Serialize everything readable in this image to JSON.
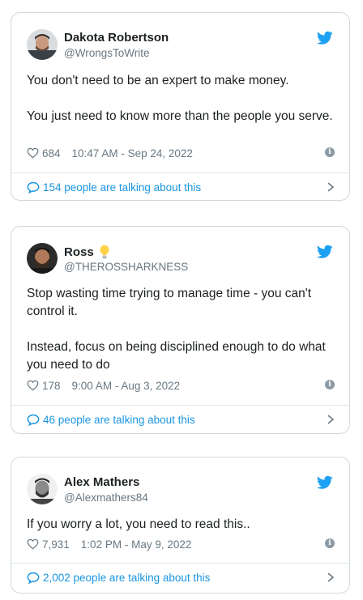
{
  "colors": {
    "twitter_blue": "#1da1f2",
    "link_blue": "#1b95e0",
    "muted": "#697882",
    "border": "#cfd9de"
  },
  "tweets": [
    {
      "name": "Dakota Robertson",
      "handle": "@WrongsToWrite",
      "badge_icon": null,
      "paragraphs": [
        "You don't need to be an expert to make money.",
        "You just need to know more than the people you serve."
      ],
      "likes": "684",
      "timestamp": "10:47 AM - Sep 24, 2022",
      "talking": "154 people are talking about this"
    },
    {
      "name": "Ross",
      "handle": "@THEROSSHARKNESS",
      "badge_icon": "lightbulb-icon",
      "paragraphs": [
        "Stop wasting time trying to manage time - you can't control it.",
        "Instead, focus on being disciplined enough to do what you need to do"
      ],
      "likes": "178",
      "timestamp": "9:00 AM - Aug 3, 2022",
      "talking": "46 people are talking about this"
    },
    {
      "name": "Alex Mathers",
      "handle": "@Alexmathers84",
      "badge_icon": null,
      "paragraphs": [
        "If you worry a lot, you need to read this.."
      ],
      "likes": "7,931",
      "timestamp": "1:02 PM - May 9, 2022",
      "talking": "2,002 people are talking about this"
    }
  ],
  "icons": {
    "platform": "twitter-bird-icon",
    "like": "heart-icon",
    "info": "info-icon",
    "replies": "speech-bubble-icon",
    "more": "chevron-right-icon"
  },
  "info_glyph": "i"
}
